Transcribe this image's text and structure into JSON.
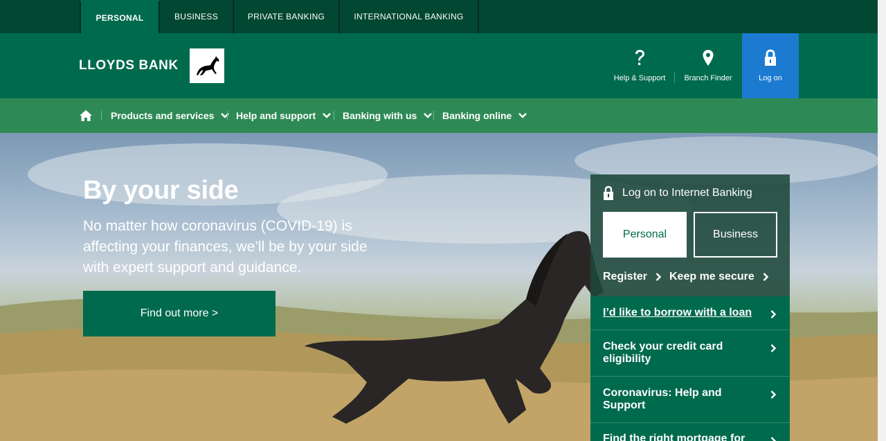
{
  "audience_tabs": [
    {
      "label": "PERSONAL",
      "active": true
    },
    {
      "label": "BUSINESS",
      "active": false
    },
    {
      "label": "PRIVATE BANKING",
      "active": false
    },
    {
      "label": "INTERNATIONAL BANKING",
      "active": false
    }
  ],
  "brand": {
    "name": "LLOYDS BANK",
    "logo_icon": "black-horse-logo-icon"
  },
  "utility": {
    "help_label": "Help & Support",
    "branch_label": "Branch Finder",
    "logon_label": "Log on"
  },
  "nav": {
    "items": [
      {
        "label": "Products and services"
      },
      {
        "label": "Help and support"
      },
      {
        "label": "Banking with us"
      },
      {
        "label": "Banking online"
      }
    ]
  },
  "hero": {
    "title": "By your side",
    "body": "No matter how coronavirus (COVID-19) is affecting your finances, we’ll be by your side with expert support and guidance.",
    "cta": "Find out more >"
  },
  "logon_panel": {
    "title": "Log on to Internet Banking",
    "personal_label": "Personal",
    "business_label": "Business",
    "register_label": "Register",
    "secure_label": "Keep me secure"
  },
  "quick_links": [
    {
      "label": "I’d like to borrow with a loan"
    },
    {
      "label": "Check your credit card eligibility"
    },
    {
      "label": "Coronavirus: Help and Support"
    },
    {
      "label": "Find the right mortgage for"
    }
  ],
  "colors": {
    "dark_green": "#024731",
    "brand_green": "#006a4d",
    "nav_green": "#2e8a55",
    "logon_blue": "#1c7bd0"
  }
}
